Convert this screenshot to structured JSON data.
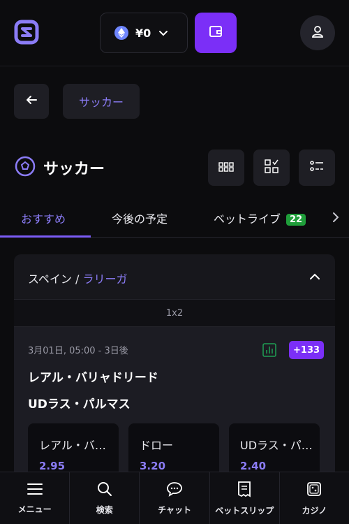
{
  "header": {
    "logo_icon": "app-logo-icon",
    "balance": "¥0",
    "currency_icon": "ethereum-icon",
    "wallet_icon": "wallet-icon",
    "profile_icon": "user-icon",
    "accent": "#7b2ff7"
  },
  "breadcrumb": {
    "back_icon": "arrow-left-icon",
    "current": "サッカー"
  },
  "page": {
    "title": "サッカー",
    "sport_icon": "soccer-ball-icon",
    "tools": [
      "grid-view-icon",
      "checklist-icon",
      "filter-settings-icon"
    ]
  },
  "tabs": {
    "items": [
      {
        "label": "おすすめ",
        "active": true
      },
      {
        "label": "今後の予定",
        "active": false
      },
      {
        "label": "ベットライブ",
        "active": false,
        "badge": "22"
      }
    ],
    "badge_color": "#1f9e3a"
  },
  "league": {
    "country": "スペイン",
    "separator": "/",
    "name": "ラリーガ",
    "market": "1x2"
  },
  "event": {
    "time": "3月01日, 05:00 - 3日後",
    "more_markets": "+133",
    "home": "レアル・バリャドリード",
    "away": "UDラス・パルマス",
    "odds": [
      {
        "label": "レアル・バリャドリード",
        "value": "2.95"
      },
      {
        "label": "ドロー",
        "value": "3.20"
      },
      {
        "label": "UDラス・パルマス",
        "value": "2.40"
      }
    ]
  },
  "bottom_nav": [
    {
      "label": "メニュー",
      "icon": "menu-icon"
    },
    {
      "label": "検索",
      "icon": "search-icon"
    },
    {
      "label": "チャット",
      "icon": "chat-icon"
    },
    {
      "label": "ベットスリップ",
      "icon": "betslip-icon"
    },
    {
      "label": "カジノ",
      "icon": "dice-icon"
    }
  ]
}
